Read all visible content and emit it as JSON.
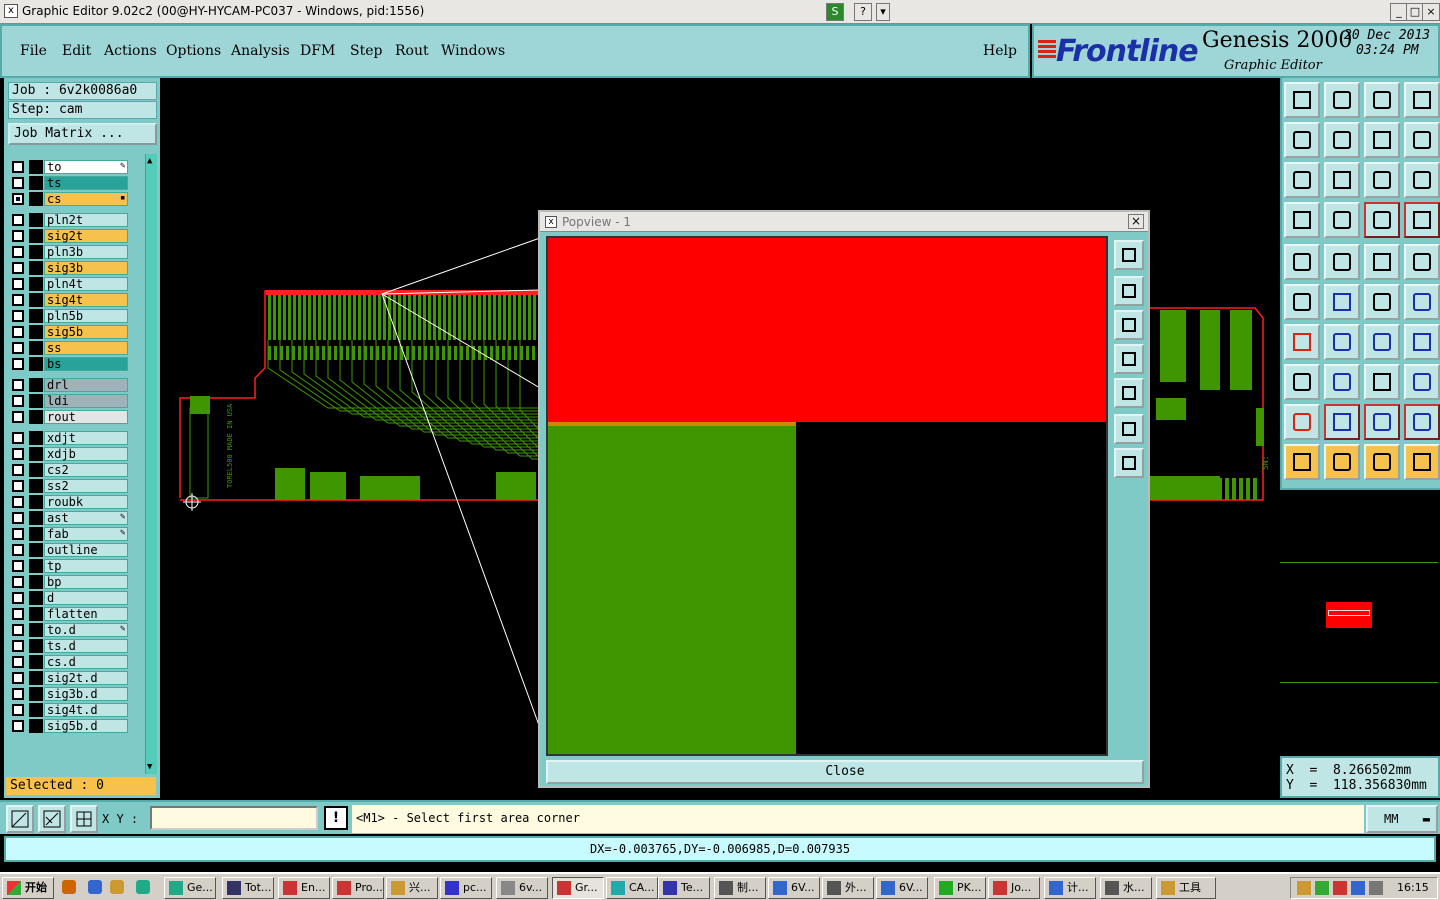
{
  "window": {
    "title": "Graphic Editor 9.02c2 (00@HY-HYCAM-PC037 - Windows, pid:1556)",
    "icon": "x-app-icon",
    "controls": [
      "S",
      "?",
      "▾",
      "_",
      "□",
      "×"
    ]
  },
  "menu": {
    "items": [
      "File",
      "Edit",
      "Actions",
      "Options",
      "Analysis",
      "DFM",
      "Step",
      "Rout",
      "Windows"
    ],
    "help": "Help"
  },
  "brand": {
    "logo": "Frontline",
    "product": "Genesis 2000",
    "subtitle": "Graphic Editor",
    "date": "20 Dec 2013",
    "time": "03:24 PM"
  },
  "job": {
    "job_line": "Job : 6v2k0086a0",
    "step_line": "Step: cam",
    "matrix_button": "Job Matrix ..."
  },
  "layers": [
    {
      "name": "to",
      "color": "#ffffff",
      "mark": "pen"
    },
    {
      "name": "ts",
      "color": "#29a39a",
      "mark": ""
    },
    {
      "name": "cs",
      "color": "#f6c24c",
      "mark": "dot",
      "checked": true
    },
    {
      "name": "pln2t",
      "color": "#bfe6e4",
      "mark": ""
    },
    {
      "name": "sig2t",
      "color": "#f6c24c",
      "mark": ""
    },
    {
      "name": "pln3b",
      "color": "#bfe6e4",
      "mark": ""
    },
    {
      "name": "sig3b",
      "color": "#f6c24c",
      "mark": ""
    },
    {
      "name": "pln4t",
      "color": "#bfe6e4",
      "mark": ""
    },
    {
      "name": "sig4t",
      "color": "#f6c24c",
      "mark": ""
    },
    {
      "name": "pln5b",
      "color": "#bfe6e4",
      "mark": ""
    },
    {
      "name": "sig5b",
      "color": "#f6c24c",
      "mark": ""
    },
    {
      "name": "ss",
      "color": "#f6c24c",
      "mark": ""
    },
    {
      "name": "bs",
      "color": "#29a39a",
      "mark": ""
    },
    {
      "name": "drl",
      "color": "#9fb2b8",
      "mark": ""
    },
    {
      "name": "ldi",
      "color": "#9fb2b8",
      "mark": ""
    },
    {
      "name": "rout",
      "color": "#e4e4e4",
      "mark": ""
    },
    {
      "name": "xdjt",
      "color": "#bfe6e4",
      "mark": ""
    },
    {
      "name": "xdjb",
      "color": "#bfe6e4",
      "mark": ""
    },
    {
      "name": "cs2",
      "color": "#bfe6e4",
      "mark": ""
    },
    {
      "name": "ss2",
      "color": "#bfe6e4",
      "mark": ""
    },
    {
      "name": "roubk",
      "color": "#bfe6e4",
      "mark": ""
    },
    {
      "name": "ast",
      "color": "#bfe6e4",
      "mark": "pen"
    },
    {
      "name": "fab",
      "color": "#bfe6e4",
      "mark": "pen"
    },
    {
      "name": "outline",
      "color": "#bfe6e4",
      "mark": ""
    },
    {
      "name": "tp",
      "color": "#bfe6e4",
      "mark": ""
    },
    {
      "name": "bp",
      "color": "#bfe6e4",
      "mark": ""
    },
    {
      "name": "d",
      "color": "#bfe6e4",
      "mark": ""
    },
    {
      "name": "flatten",
      "color": "#bfe6e4",
      "mark": ""
    },
    {
      "name": "to.d",
      "color": "#bfe6e4",
      "mark": "pen"
    },
    {
      "name": "ts.d",
      "color": "#bfe6e4",
      "mark": ""
    },
    {
      "name": "cs.d",
      "color": "#bfe6e4",
      "mark": ""
    },
    {
      "name": "sig2t.d",
      "color": "#bfe6e4",
      "mark": ""
    },
    {
      "name": "sig3b.d",
      "color": "#bfe6e4",
      "mark": ""
    },
    {
      "name": "sig4t.d",
      "color": "#bfe6e4",
      "mark": ""
    },
    {
      "name": "sig5b.d",
      "color": "#bfe6e4",
      "mark": ""
    }
  ],
  "selected": "Selected : 0",
  "board": {
    "silk_text_1": "TOREL500  MADE IN USA",
    "silk_text_2": "SN:"
  },
  "popview": {
    "title": "Popview - 1",
    "close_x": "×",
    "close_button": "Close"
  },
  "coords": {
    "x": "X  =  8.266502mm",
    "y": "Y  =  118.356830mm"
  },
  "bottom": {
    "xy_label": "X Y :",
    "xy_value": "",
    "exclaim": "!",
    "prompt": "<M1> - Select first area corner",
    "units": "MM"
  },
  "status": "DX=-0.003765,DY=-0.006985,D=0.007935",
  "taskbar": {
    "start": "开始",
    "tasks": [
      "Ge...",
      "Tot...",
      "En...",
      "Pro...",
      "兴...",
      "pc...",
      "6v...",
      "Gr...",
      "CA...",
      "Te...",
      "制...",
      "6V...",
      "外...",
      "6V...",
      "PK...",
      "Jo...",
      "计...",
      "水...",
      "工具"
    ],
    "clock": "16:15"
  },
  "colors": {
    "panel": "#7fc9c6",
    "field": "#bfe6e4",
    "highlight": "#f6c24c",
    "copper_top": "#ff0000",
    "copper_green": "#3f9600"
  }
}
